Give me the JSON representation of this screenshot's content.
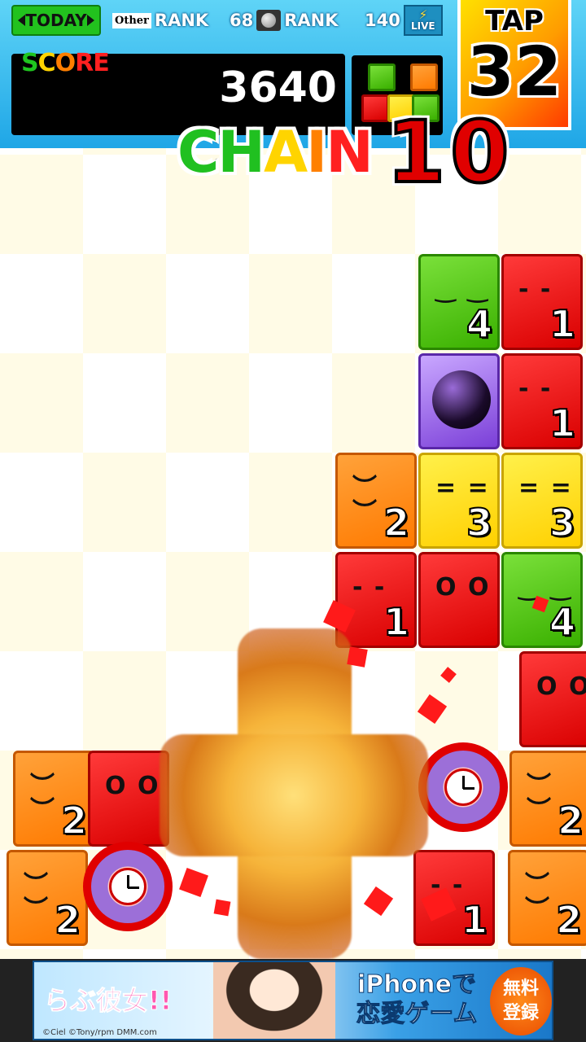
{
  "header": {
    "today_label": "TODAY",
    "other_logo": "Other",
    "other_rank_label": "RANK",
    "world_rank_value": "68",
    "world_rank_label": "RANK",
    "live_count": "140",
    "live_label": "LIVE",
    "score_label": [
      "S",
      "C",
      "O",
      "R",
      "E"
    ],
    "score_value": "3640",
    "tap_label": "TAP",
    "tap_value": "32"
  },
  "chain": {
    "word_letters": [
      "C",
      "H",
      "A",
      "I",
      "N"
    ],
    "value": "10"
  },
  "board": {
    "blocks": [
      {
        "color": "green",
        "face": "‿ ‿",
        "num": "4"
      },
      {
        "color": "red",
        "face": "- -",
        "num": "1"
      },
      {
        "color": "purple",
        "item": "bomb-icon"
      },
      {
        "color": "red",
        "face": "- -",
        "num": "1"
      },
      {
        "color": "orange",
        "face": "︶ ︶",
        "num": "2"
      },
      {
        "color": "yellow",
        "face": "= =",
        "num": "3"
      },
      {
        "color": "yellow",
        "face": "= =",
        "num": "3"
      },
      {
        "color": "red",
        "face": "- -",
        "num": "1"
      },
      {
        "color": "red",
        "face": "O O",
        "num": ""
      },
      {
        "color": "green",
        "face": "‿ ‿",
        "num": "4"
      },
      {
        "color": "red",
        "face": "O O",
        "num": ""
      },
      {
        "color": "orange",
        "face": "︶ ︶",
        "num": "2"
      },
      {
        "color": "red",
        "face": "O O",
        "num": ""
      },
      {
        "color": "orange",
        "face": "︶ ︶",
        "num": "2"
      },
      {
        "color": "orange",
        "face": "︶ ︶",
        "num": "2"
      },
      {
        "color": "red",
        "face": "- -",
        "num": "1"
      },
      {
        "color": "orange",
        "face": "︶ ︶",
        "num": "2"
      }
    ],
    "clocks": [
      "alarm-clock-icon",
      "alarm-clock-icon"
    ]
  },
  "ad": {
    "logo_text": "らぶ彼女!!",
    "headline_1": "iPhoneで",
    "headline_2": "恋愛ゲーム",
    "cta_1": "無料",
    "cta_2": "登録",
    "credit": "©Ciel ©Tony/rpm DMM.com"
  }
}
